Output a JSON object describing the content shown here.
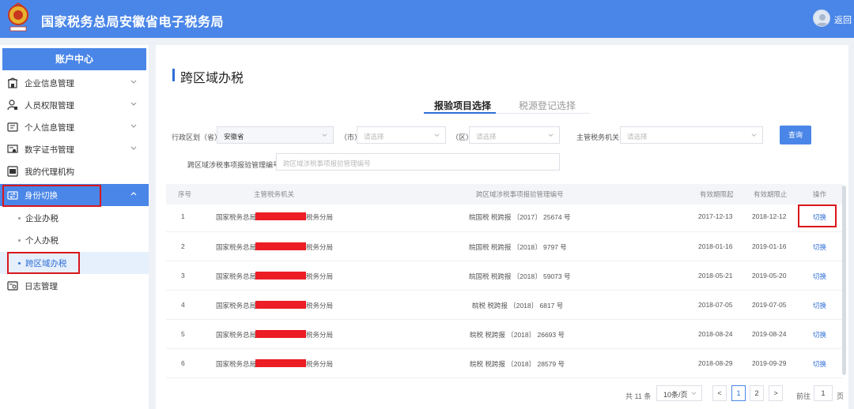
{
  "header": {
    "site_title": "国家税务总局安徽省电子税务局",
    "back_label": "返回",
    "brand_color": "#4a86e8"
  },
  "sidebar": {
    "title": "账户中心",
    "items": [
      {
        "label": "企业信息管理",
        "icon": "building-icon"
      },
      {
        "label": "人员权限管理",
        "icon": "user-lock-icon"
      },
      {
        "label": "个人信息管理",
        "icon": "id-card-icon"
      },
      {
        "label": "数字证书管理",
        "icon": "certificate-icon"
      },
      {
        "label": "我的代理机构",
        "icon": "agency-icon"
      },
      {
        "label": "身份切换",
        "icon": "switch-icon",
        "active": true
      },
      {
        "label": "日志管理",
        "icon": "log-icon"
      }
    ],
    "sub_items": [
      "企业办税",
      "个人办税",
      "跨区域办税"
    ],
    "selected_sub": "跨区域办税"
  },
  "main": {
    "title": "跨区域办税",
    "tabs": [
      "报验项目选择",
      "税源登记选择"
    ],
    "filters": {
      "region_label": "行政区划（省）",
      "province_value": "安徽省",
      "city_label": "（市）",
      "city_placeholder": "请选择",
      "district_label": "（区）",
      "district_placeholder": "请选择",
      "authority_label": "主管税务机关",
      "authority_placeholder": "请选择",
      "query_button": "查询",
      "code_label": "跨区域涉税事项报验管理编号",
      "code_placeholder": "跨区域涉税事项报验管理编号"
    },
    "table": {
      "headers": [
        "序号",
        "主管税务机关",
        "跨区域涉税事项报验管理编号",
        "有效期限起",
        "有效期限止",
        "操作"
      ],
      "rows": [
        {
          "no": "1",
          "org_prefix": "国家税务总局",
          "org_suffix": "税务分局",
          "code": "皖国税 税跨报 〔2017〕 25674 号",
          "start": "2017-12-13",
          "end": "2018-12-12",
          "op": "切换"
        },
        {
          "no": "2",
          "org_prefix": "国家税务总局",
          "org_suffix": "税务分局",
          "code": "皖国税 税跨报 〔2018〕 9797 号",
          "start": "2018-01-16",
          "end": "2019-01-16",
          "op": "切换"
        },
        {
          "no": "3",
          "org_prefix": "国家税务总局",
          "org_suffix": "税务分局",
          "code": "皖国税 税跨报 〔2018〕 59073 号",
          "start": "2018-05-21",
          "end": "2019-05-20",
          "op": "切换"
        },
        {
          "no": "4",
          "org_prefix": "国家税务总局",
          "org_suffix": "税务分局",
          "code": "皖税 税跨报 〔2018〕 6817 号",
          "start": "2018-07-05",
          "end": "2019-07-05",
          "op": "切换"
        },
        {
          "no": "5",
          "org_prefix": "国家税务总局",
          "org_suffix": "税务分局",
          "code": "皖税 税跨报 〔2018〕 26693 号",
          "start": "2018-08-24",
          "end": "2019-08-24",
          "op": "切换"
        },
        {
          "no": "6",
          "org_prefix": "国家税务总局",
          "org_suffix": "税务分局",
          "code": "皖税 税跨报 〔2018〕 28579 号",
          "start": "2018-08-29",
          "end": "2019-09-29",
          "op": "切换"
        }
      ]
    },
    "pagination": {
      "total_text": "共 11 条",
      "page_size": "10条/页",
      "prev": "<",
      "pages": [
        "1",
        "2"
      ],
      "current": "1",
      "next": ">",
      "goto_label": "前往",
      "goto_value": "1",
      "page_suffix": "页"
    }
  }
}
